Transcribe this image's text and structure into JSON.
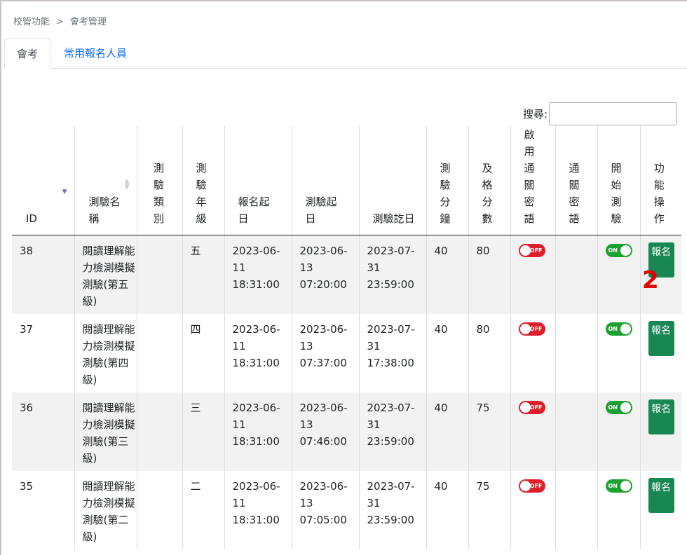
{
  "breadcrumb": {
    "parent": "校管功能",
    "separator": ">",
    "current": "會考管理"
  },
  "tabs": [
    {
      "label": "會考"
    },
    {
      "label": "常用報名人員"
    }
  ],
  "search": {
    "label": "搜尋:",
    "value": ""
  },
  "table": {
    "headers": [
      "ID",
      "測驗名稱",
      "測驗類別",
      "測驗年級",
      "報名起日",
      "測驗起日",
      "測驗訖日",
      "測驗分鐘",
      "及格分數",
      "啟用通關密語",
      "通關密語",
      "開始測驗",
      "功能操作"
    ],
    "rows": [
      {
        "id": "38",
        "name": "閱讀理解能力檢測模擬測驗(第五級)",
        "category": "",
        "grade": "五",
        "reg_start": "2023-06-11 18:31:00",
        "test_start": "2023-06-13 07:20:00",
        "test_end": "2023-07-31 23:59:00",
        "minutes": "40",
        "pass_score": "80",
        "password_enabled": "OFF",
        "password": "",
        "started": "ON",
        "action": "報名"
      },
      {
        "id": "37",
        "name": "閱讀理解能力檢測模擬測驗(第四級)",
        "category": "",
        "grade": "四",
        "reg_start": "2023-06-11 18:31:00",
        "test_start": "2023-06-13 07:37:00",
        "test_end": "2023-07-31 17:38:00",
        "minutes": "40",
        "pass_score": "80",
        "password_enabled": "OFF",
        "password": "",
        "started": "ON",
        "action": "報名"
      },
      {
        "id": "36",
        "name": "閱讀理解能力檢測模擬測驗(第三級)",
        "category": "",
        "grade": "三",
        "reg_start": "2023-06-11 18:31:00",
        "test_start": "2023-06-13 07:46:00",
        "test_end": "2023-07-31 23:59:00",
        "minutes": "40",
        "pass_score": "75",
        "password_enabled": "OFF",
        "password": "",
        "started": "ON",
        "action": "報名"
      },
      {
        "id": "35",
        "name": "閱讀理解能力檢測模擬測驗(第二級)",
        "category": "",
        "grade": "二",
        "reg_start": "2023-06-11 18:31:00",
        "test_start": "2023-06-13 07:05:00",
        "test_end": "2023-07-31 23:59:00",
        "minutes": "40",
        "pass_score": "75",
        "password_enabled": "OFF",
        "password": "",
        "started": "ON",
        "action": "報名"
      }
    ]
  },
  "annotation": {
    "marker": "2"
  },
  "colors": {
    "link": "#0d6efd",
    "toggle_off": "#e01e2b",
    "toggle_on": "#1ba12d",
    "action_button": "#198754",
    "marker": "#e00000"
  }
}
